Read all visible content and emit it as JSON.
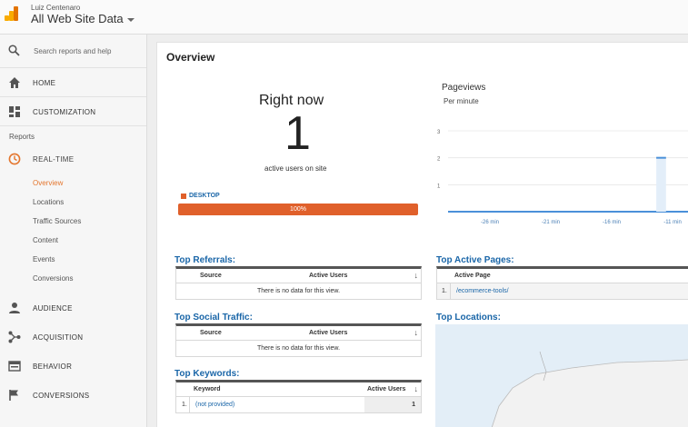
{
  "header": {
    "user_name": "Luiz Centenaro",
    "property": "All Web Site Data"
  },
  "sidebar": {
    "search_placeholder": "Search reports and help",
    "home": "HOME",
    "customization": "CUSTOMIZATION",
    "reports_label": "Reports",
    "realtime": "REAL-TIME",
    "realtime_items": [
      "Overview",
      "Locations",
      "Traffic Sources",
      "Content",
      "Events",
      "Conversions"
    ],
    "audience": "AUDIENCE",
    "acquisition": "ACQUISITION",
    "behavior": "BEHAVIOR",
    "conversions": "CONVERSIONS"
  },
  "main": {
    "title": "Overview",
    "right_now": {
      "title": "Right now",
      "count": "1",
      "subtitle": "active users on site",
      "device_label": "DESKTOP",
      "device_percent": "100%",
      "device_color": "#e0602b"
    },
    "pageviews": {
      "title": "Pageviews",
      "subtitle": "Per minute"
    },
    "top_referrals": {
      "title": "Top Referrals:",
      "col1": "Source",
      "col2": "Active Users",
      "empty": "There is no data for this view."
    },
    "top_social": {
      "title": "Top Social Traffic:",
      "col1": "Source",
      "col2": "Active Users",
      "empty": "There is no data for this view."
    },
    "top_keywords": {
      "title": "Top Keywords:",
      "col1": "Keyword",
      "col2": "Active Users",
      "rows": [
        {
          "rank": "1.",
          "keyword": "(not provided)",
          "users": "1"
        }
      ]
    },
    "top_pages": {
      "title": "Top Active Pages:",
      "col1": "Active Page",
      "rows": [
        {
          "rank": "1.",
          "page": "/ecommerce-tools/"
        }
      ]
    },
    "top_locations": {
      "title": "Top Locations:"
    }
  },
  "chart_data": {
    "type": "bar",
    "subtitle": "Per minute",
    "yticks": [
      1,
      2,
      3
    ],
    "ylim": [
      0,
      3
    ],
    "xticks": [
      "-26 min",
      "-21 min",
      "-16 min",
      "-11 min"
    ],
    "series": [
      {
        "values": [
          0,
          0,
          0,
          0,
          0,
          0,
          0,
          0,
          0,
          0,
          0,
          0,
          0,
          0,
          0,
          0,
          0,
          0,
          2,
          0,
          0,
          0
        ]
      }
    ],
    "bar_color": "#4a90d9"
  }
}
